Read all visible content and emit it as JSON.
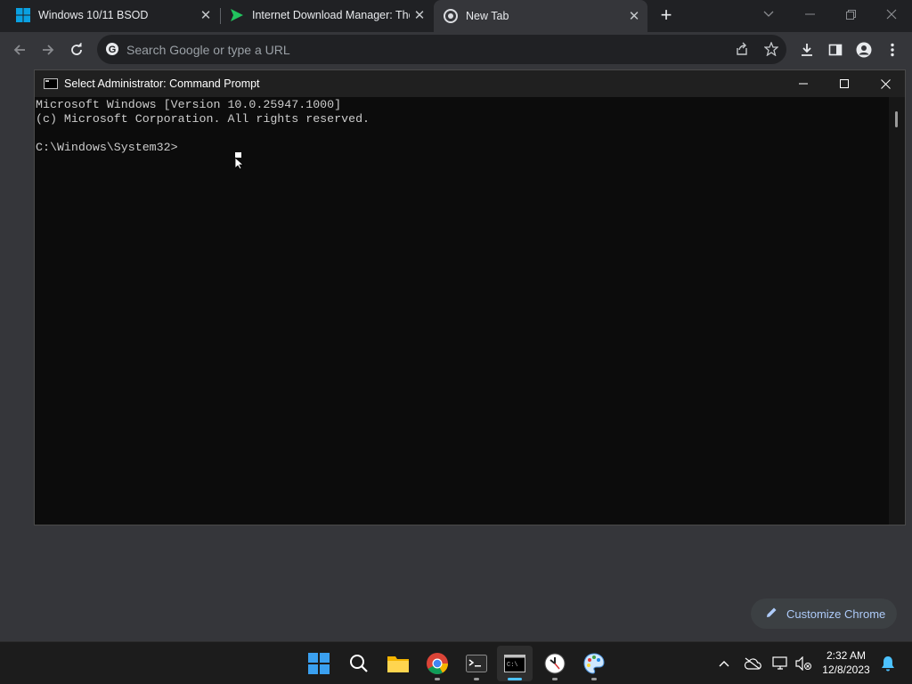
{
  "tabs": [
    {
      "title": "Windows 10/11 BSOD"
    },
    {
      "title": "Internet Download Manager: The"
    },
    {
      "title": "New Tab"
    }
  ],
  "omnibox": {
    "placeholder": "Search Google or type a URL"
  },
  "cmd": {
    "title": "Select Administrator: Command Prompt",
    "lines": [
      "Microsoft Windows [Version 10.0.25947.1000]",
      "(c) Microsoft Corporation. All rights reserved.",
      "",
      "C:\\Windows\\System32>"
    ]
  },
  "customize": {
    "label": "Customize Chrome"
  },
  "clock": {
    "time": "2:32 AM",
    "date": "12/8/2023"
  },
  "colors": {
    "chrome_dark": "#202124",
    "page_bg": "#35363a",
    "accent_link": "#aecbfa",
    "win_blue": "#4cc2ff"
  }
}
